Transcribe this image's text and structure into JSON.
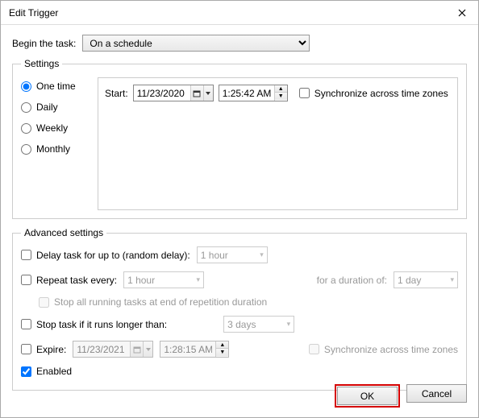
{
  "window": {
    "title": "Edit Trigger"
  },
  "begin": {
    "label": "Begin the task:",
    "value": "On a schedule"
  },
  "settings": {
    "legend": "Settings",
    "radios": {
      "one_time": "One time",
      "daily": "Daily",
      "weekly": "Weekly",
      "monthly": "Monthly"
    },
    "selected": "one_time",
    "start_label": "Start:",
    "start_date": "11/23/2020",
    "start_time": "1:25:42 AM",
    "sync_label": "Synchronize across time zones",
    "sync_checked": false
  },
  "advanced": {
    "legend": "Advanced settings",
    "delay": {
      "label": "Delay task for up to (random delay):",
      "value": "1 hour",
      "checked": false
    },
    "repeat": {
      "label": "Repeat task every:",
      "value": "1 hour",
      "checked": false,
      "duration_label": "for a duration of:",
      "duration_value": "1 day"
    },
    "stop_repetition": {
      "label": "Stop all running tasks at end of repetition duration",
      "checked": false
    },
    "stop_longer": {
      "label": "Stop task if it runs longer than:",
      "value": "3 days",
      "checked": false
    },
    "expire": {
      "label": "Expire:",
      "date": "11/23/2021",
      "time": "1:28:15 AM",
      "checked": false,
      "sync_label": "Synchronize across time zones",
      "sync_checked": false
    },
    "enabled": {
      "label": "Enabled",
      "checked": true
    }
  },
  "buttons": {
    "ok": "OK",
    "cancel": "Cancel"
  }
}
